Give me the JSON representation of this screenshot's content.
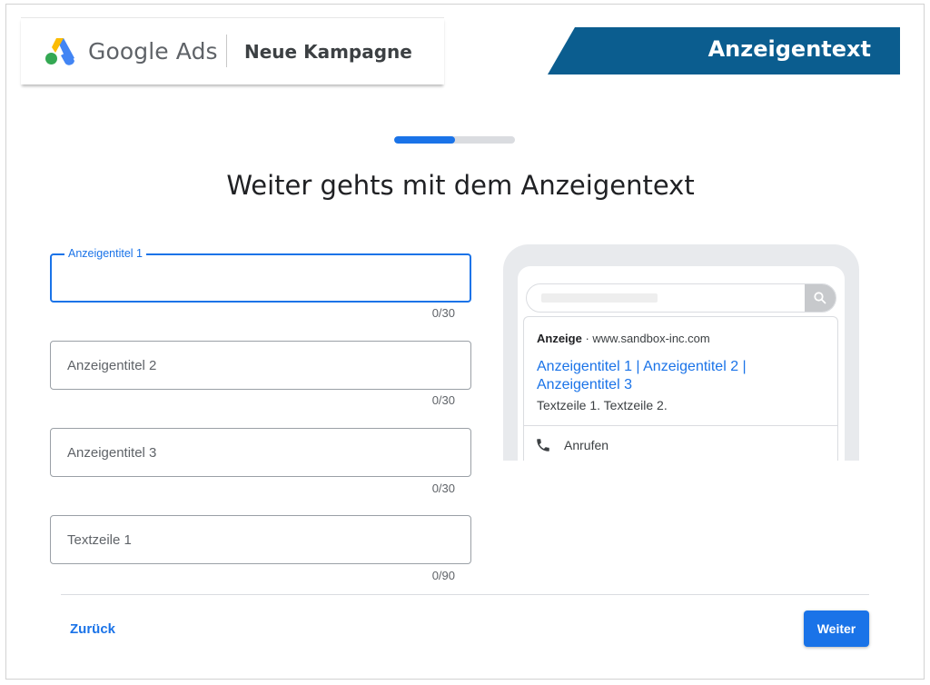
{
  "header": {
    "brand": "Google Ads",
    "campaign_label": "Neue Kampagne",
    "step_title": "Anzeigentext",
    "step_color": "#0b5d8f"
  },
  "progress": {
    "value": 0.5
  },
  "page_title": "Weiter gehts mit dem Anzeigentext",
  "fields": [
    {
      "label": "Anzeigentitel 1",
      "value": "",
      "counter": "0/30",
      "focused": true
    },
    {
      "placeholder": "Anzeigentitel 2",
      "value": "",
      "counter": "0/30"
    },
    {
      "placeholder": "Anzeigentitel 3",
      "value": "",
      "counter": "0/30"
    },
    {
      "placeholder": "Textzeile 1",
      "value": "",
      "counter": "0/90"
    }
  ],
  "preview": {
    "ad_badge": "Anzeige",
    "url": " · www.sandbox-inc.com",
    "headline": "Anzeigentitel 1 | Anzeigentitel 2 | Anzeigentitel 3",
    "description": "Textzeile 1. Textzeile 2.",
    "call_label": "Anrufen"
  },
  "footer": {
    "back_label": "Zurück",
    "next_label": "Weiter"
  },
  "colors": {
    "accent": "#1a73e8",
    "banner": "#0b5d8f"
  }
}
